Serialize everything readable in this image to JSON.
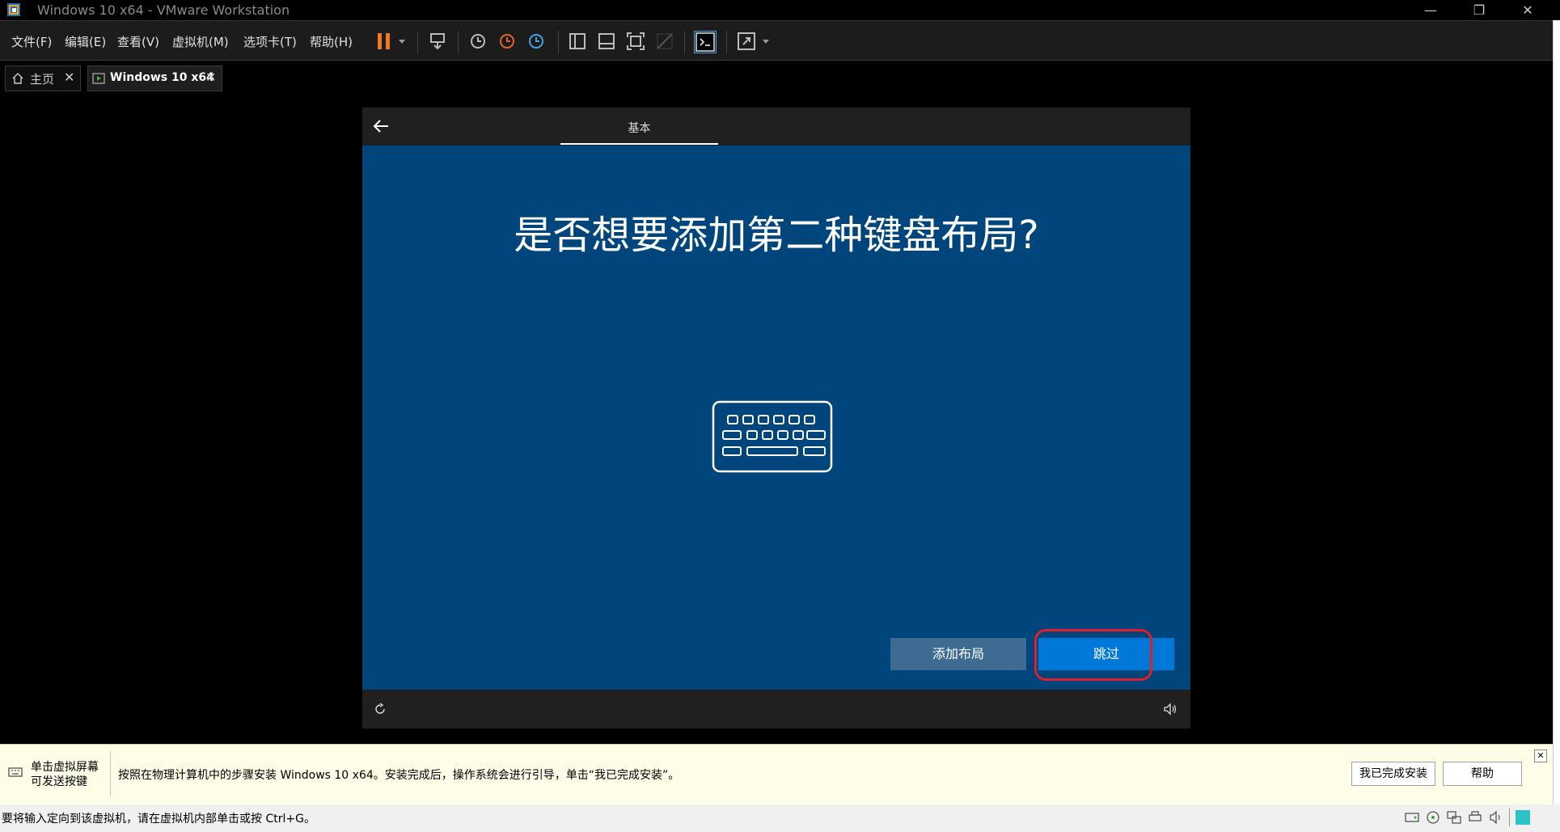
{
  "window": {
    "title": "Windows 10 x64 - VMware Workstation"
  },
  "menu": {
    "file": "文件(F)",
    "edit": "编辑(E)",
    "view": "查看(V)",
    "vm": "虚拟机(M)",
    "tabs": "选项卡(T)",
    "help": "帮助(H)"
  },
  "tabs": [
    {
      "label": "主页"
    },
    {
      "label": "Windows 10 x64"
    }
  ],
  "vm": {
    "header_tab": "基本",
    "heading": "是否想要添加第二种键盘布局?",
    "add_label": "添加布局",
    "skip_label": "跳过"
  },
  "notify": {
    "hint_line1": "单击虚拟屏幕",
    "hint_line2": "可发送按键",
    "message": "按照在物理计算机中的步骤安装 Windows 10 x64。安装完成后，操作系统会进行引导，单击“我已完成安装”。",
    "done_label": "我已完成安装",
    "help_label": "帮助"
  },
  "status": {
    "text": "要将输入定向到该虚拟机，请在虚拟机内部单击或按 Ctrl+G。"
  },
  "colors": {
    "vm_bg": "#00457c",
    "primary": "#0078d7",
    "secondary": "#3e6b91",
    "highlight": "#e01e2e"
  }
}
